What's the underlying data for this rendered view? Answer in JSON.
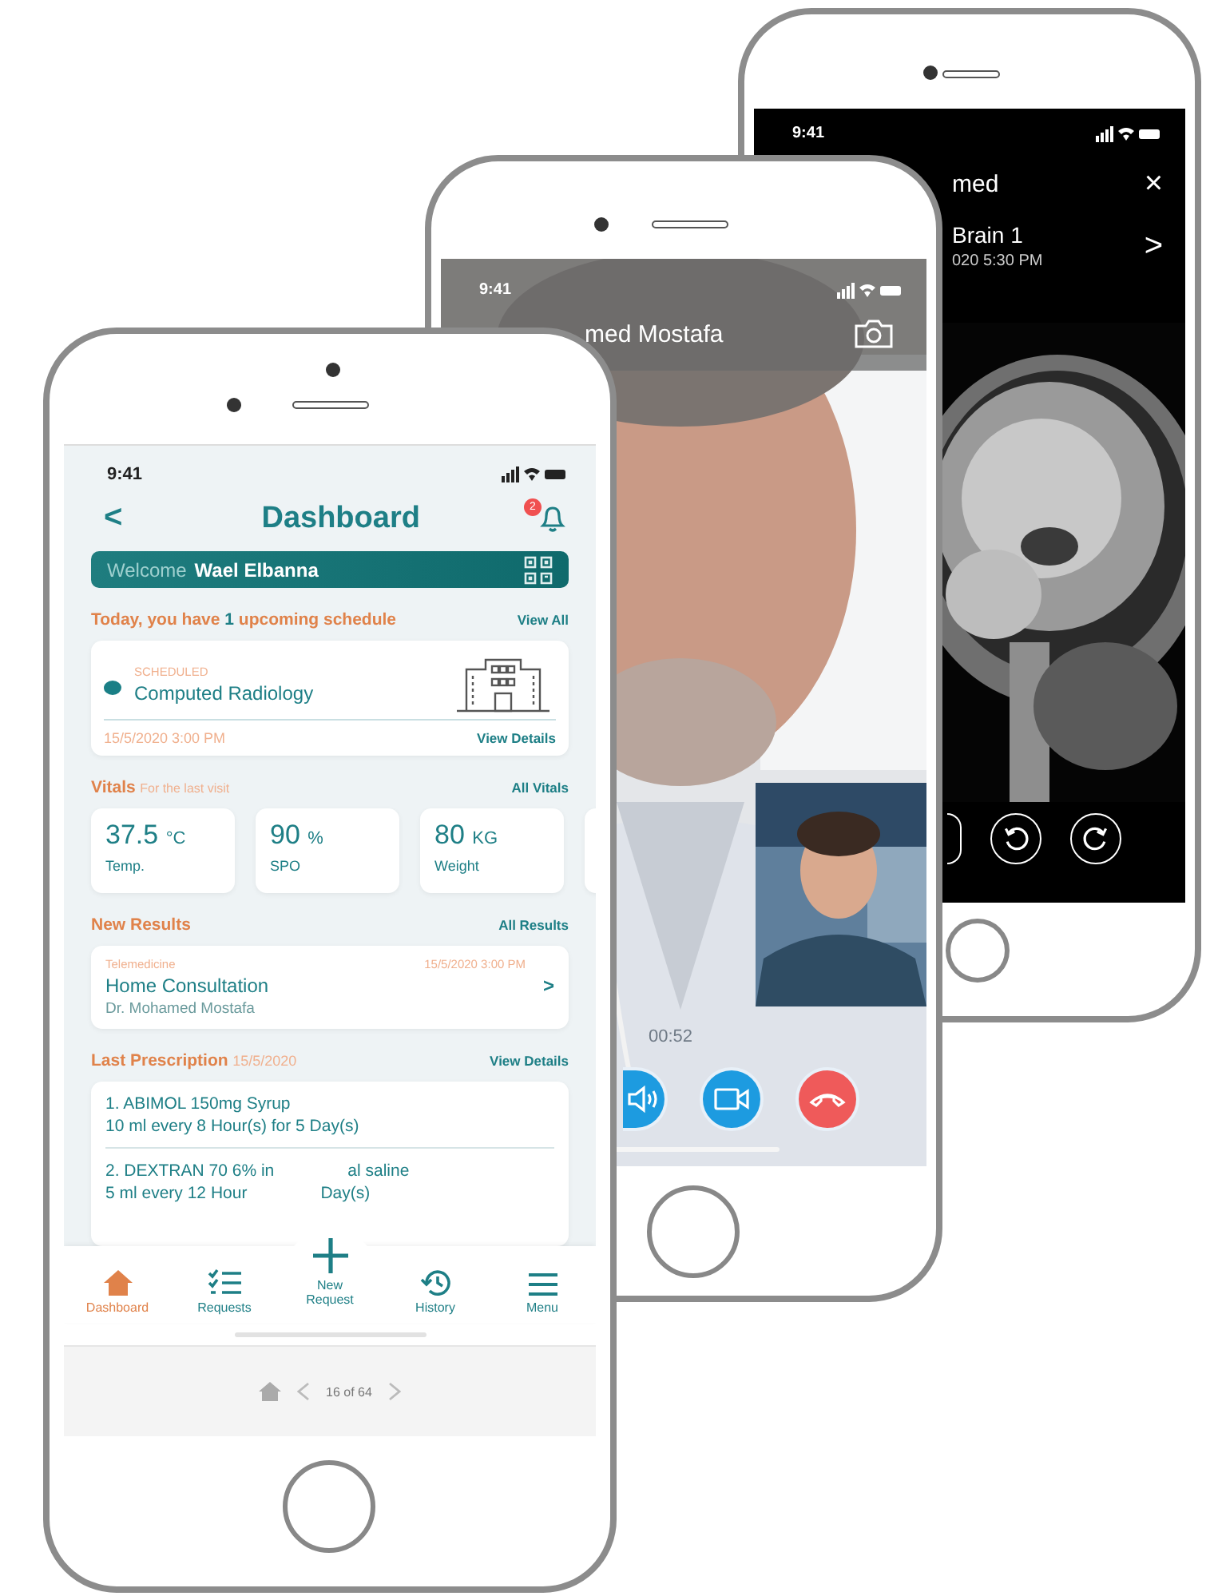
{
  "scan_viewer": {
    "status_time": "9:41",
    "title": "med",
    "close": "×",
    "scan": {
      "name": "Brain 1",
      "date": "020 5:30 PM",
      "chevron": ">"
    },
    "controls": [
      {
        "kind": "blank"
      },
      {
        "kind": "rotate-left"
      },
      {
        "kind": "rotate-right"
      }
    ]
  },
  "video_call": {
    "status_time": "9:41",
    "caller": "med Mostafa",
    "timer": "00:52",
    "controls": [
      {
        "kind": "speaker"
      },
      {
        "kind": "video"
      },
      {
        "kind": "end"
      }
    ]
  },
  "dashboard": {
    "status_time": "9:41",
    "back": "<",
    "title": "Dashboard",
    "notifications": "2",
    "welcome": {
      "greeting": "Welcome",
      "name": "Wael Elbanna"
    },
    "schedule": {
      "heading": {
        "before": "Today, you have",
        "count": "1",
        "after": "upcoming schedule"
      },
      "link": "View All",
      "card": {
        "status": "SCHEDULED",
        "title": "Computed Radiology",
        "date": "15/5/2020 3:00 PM",
        "link": "View Details"
      }
    },
    "vitals": {
      "title": "Vitals",
      "subtitle": "For the last visit",
      "link": "All Vitals",
      "items": [
        {
          "value": "37.5",
          "unit": "°C",
          "label": "Temp."
        },
        {
          "value": "90",
          "unit": "%",
          "label": "SPO"
        },
        {
          "value": "80",
          "unit": "KG",
          "label": "Weight"
        }
      ]
    },
    "results": {
      "title": "New Results",
      "link": "All Results",
      "items": [
        {
          "category": "Telemedicine",
          "date": "15/5/2020 3:00 PM",
          "title": "Home Consultation",
          "doctor": "Dr. Mohamed Mostafa",
          "chevron": ">"
        }
      ]
    },
    "prescription": {
      "title": "Last Prescription",
      "date": "15/5/2020",
      "link": "View Details",
      "items": [
        {
          "lines": [
            [
              "1. ABIMOL 150mg Syrup"
            ],
            [
              "10 ml every 8 Hour(s) for 5 Day(s)"
            ]
          ]
        },
        {
          "lines": [
            [
              "2. DEXTRAN 70 6% in",
              "al saline"
            ],
            [
              "5 ml every 12 Hour",
              "Day(s)"
            ]
          ]
        }
      ]
    },
    "tabs": [
      {
        "kind": "home",
        "label": "Dashboard",
        "selected": true
      },
      {
        "kind": "requests",
        "label": "Requests",
        "selected": false
      },
      {
        "kind": "new",
        "label": "New\nRequest",
        "selected": false
      },
      {
        "kind": "history",
        "label": "History",
        "selected": false
      },
      {
        "kind": "menu",
        "label": "Menu",
        "selected": false
      }
    ],
    "pager": {
      "label": "16 of 64"
    }
  }
}
